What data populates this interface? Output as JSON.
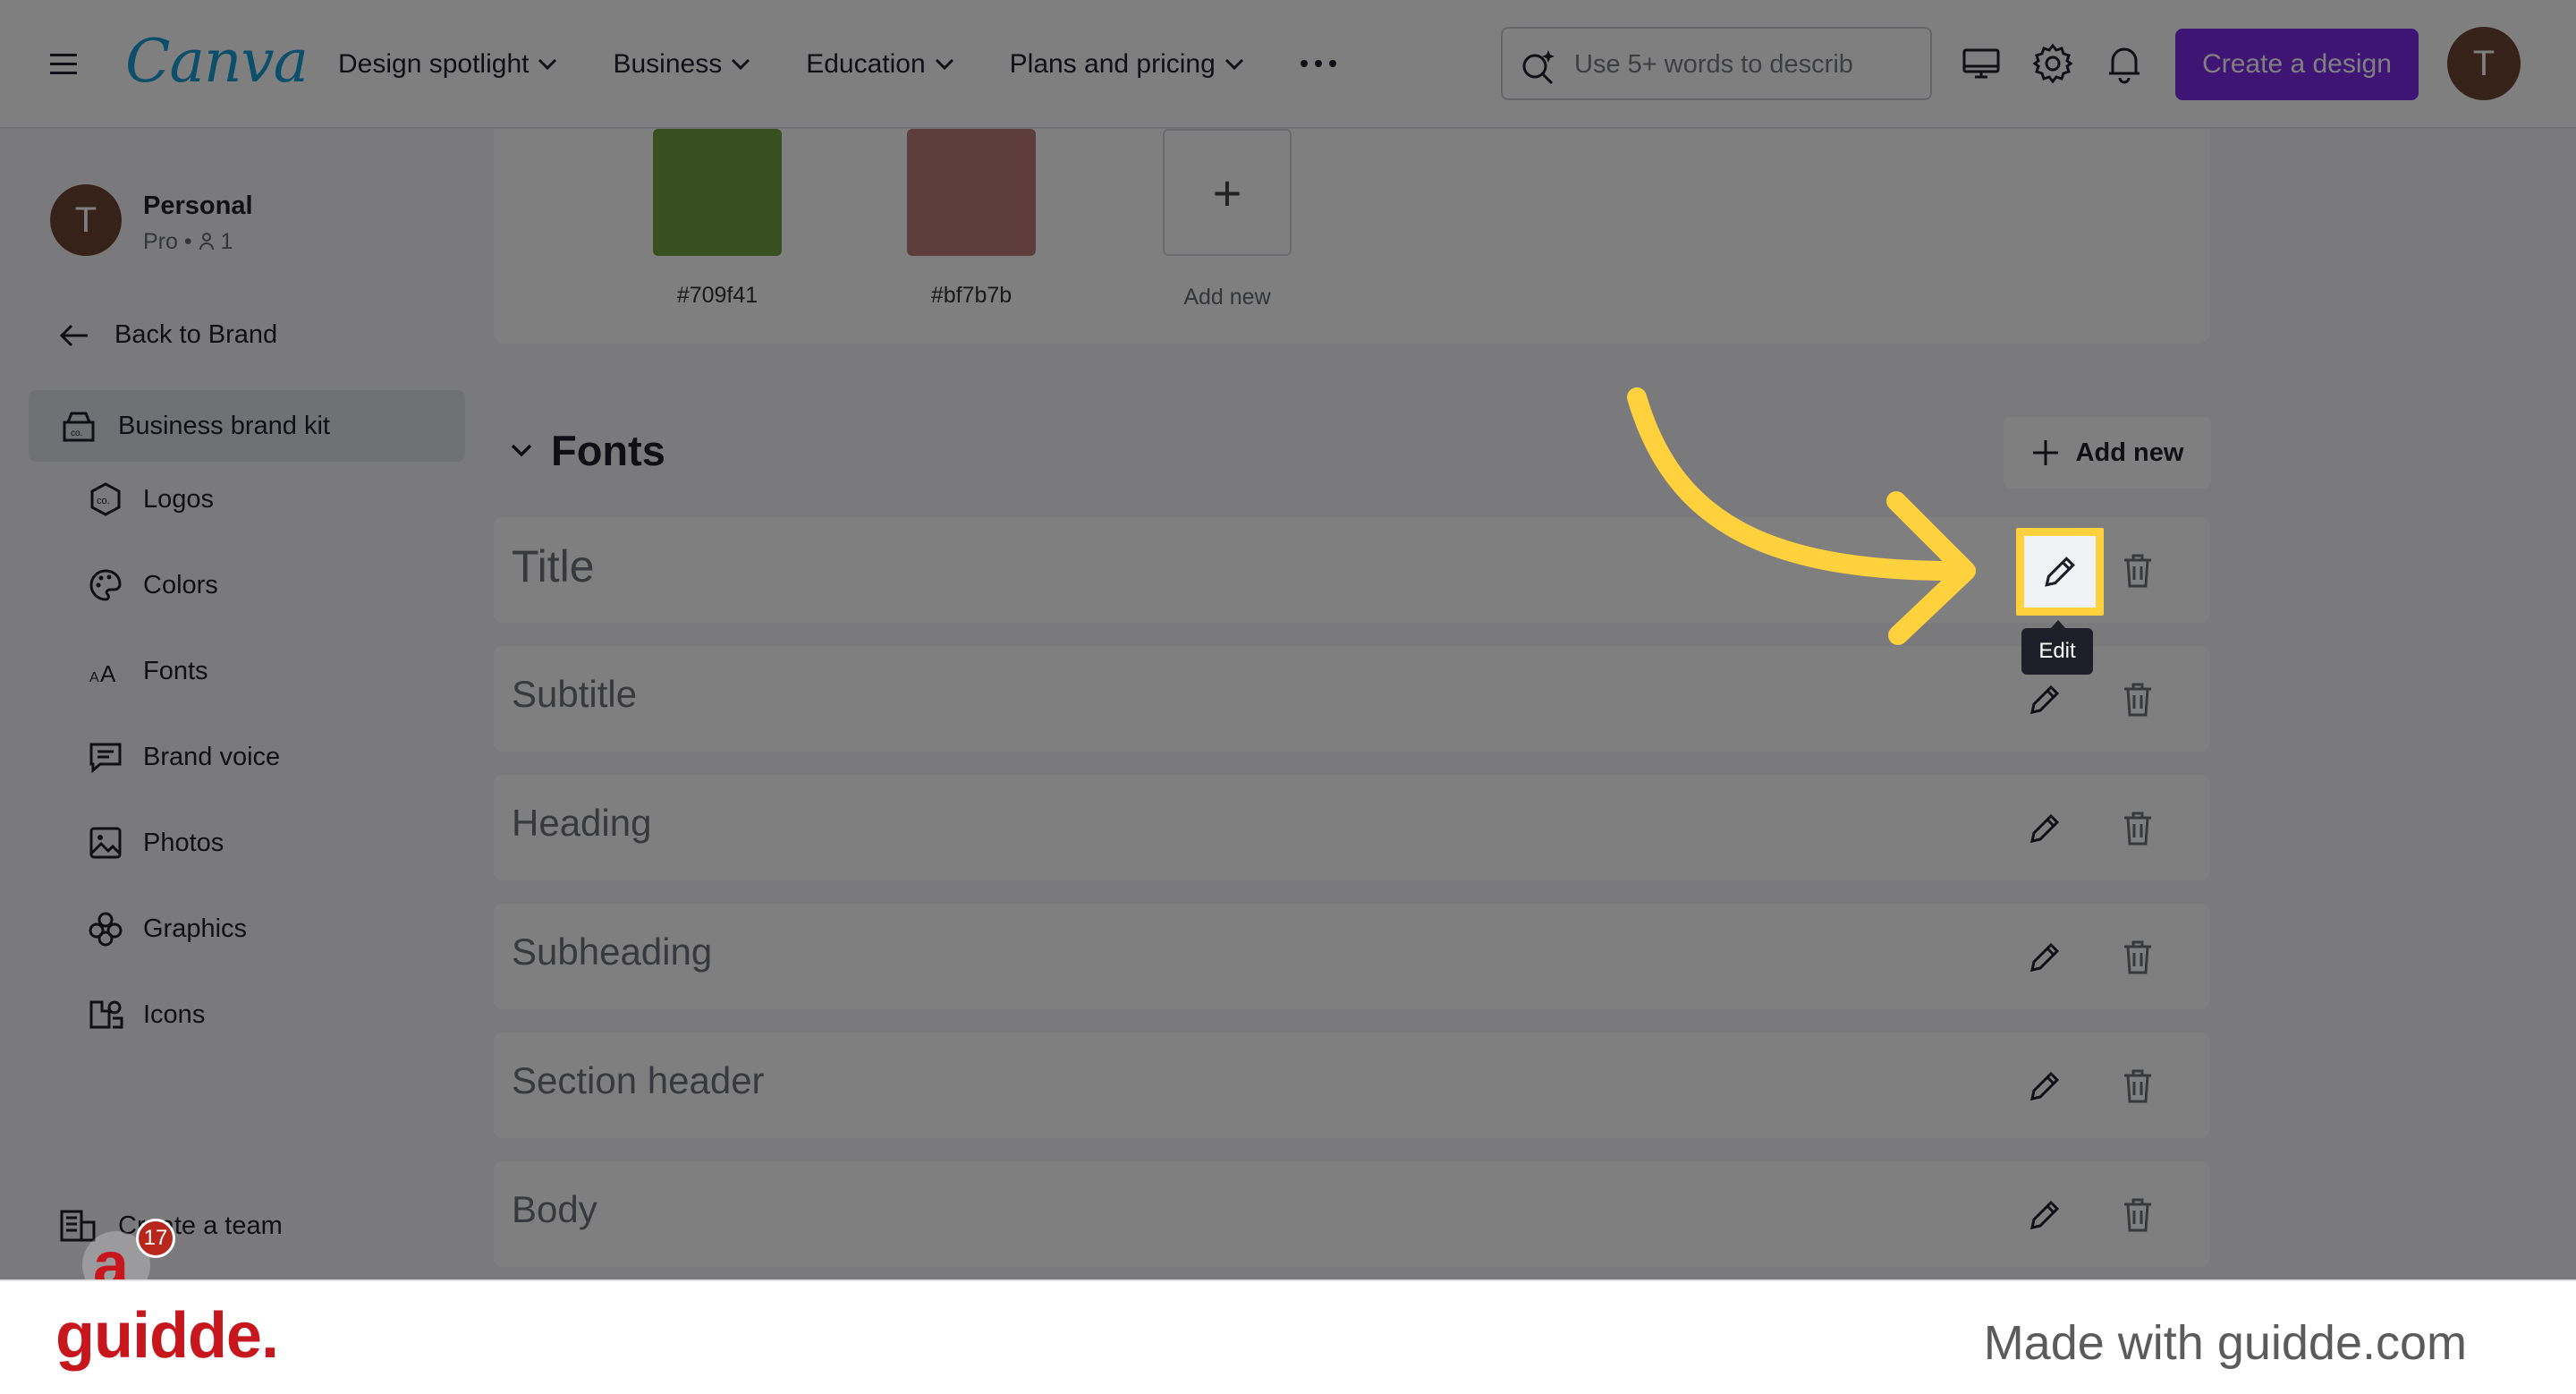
{
  "header": {
    "logo": "Canva",
    "nav": [
      {
        "label": "Design spotlight"
      },
      {
        "label": "Business"
      },
      {
        "label": "Education"
      },
      {
        "label": "Plans and pricing"
      }
    ],
    "search_placeholder": "Use 5+ words to describ",
    "create_label": "Create a design",
    "avatar_initial": "T"
  },
  "sidebar": {
    "profile_initial": "T",
    "profile_name": "Personal",
    "profile_plan": "Pro",
    "profile_members": "1",
    "back_label": "Back to Brand",
    "brand_kit_label": "Business brand kit",
    "items": [
      {
        "label": "Logos",
        "icon": "logo-icon"
      },
      {
        "label": "Colors",
        "icon": "palette-icon"
      },
      {
        "label": "Fonts",
        "icon": "fonts-icon"
      },
      {
        "label": "Brand voice",
        "icon": "brand-voice-icon"
      },
      {
        "label": "Photos",
        "icon": "photo-icon"
      },
      {
        "label": "Graphics",
        "icon": "graphics-icon"
      },
      {
        "label": "Icons",
        "icon": "icons-icon"
      }
    ],
    "create_team_label": "Create a team"
  },
  "colors": {
    "swatches": [
      {
        "hex": "#709f41",
        "label": "#709f41"
      },
      {
        "hex": "#bf7b7b",
        "label": "#bf7b7b"
      }
    ],
    "add_label": "Add new"
  },
  "fonts": {
    "heading": "Fonts",
    "add_new_label": "Add new",
    "rows": [
      {
        "label": "Title"
      },
      {
        "label": "Subtitle"
      },
      {
        "label": "Heading"
      },
      {
        "label": "Subheading"
      },
      {
        "label": "Section header"
      },
      {
        "label": "Body"
      }
    ]
  },
  "overlay": {
    "tooltip": "Edit",
    "highlight_color": "#ffd23d",
    "badge_count": "17"
  },
  "footer": {
    "logo": "guidde.",
    "tagline": "Made with guidde.com"
  }
}
